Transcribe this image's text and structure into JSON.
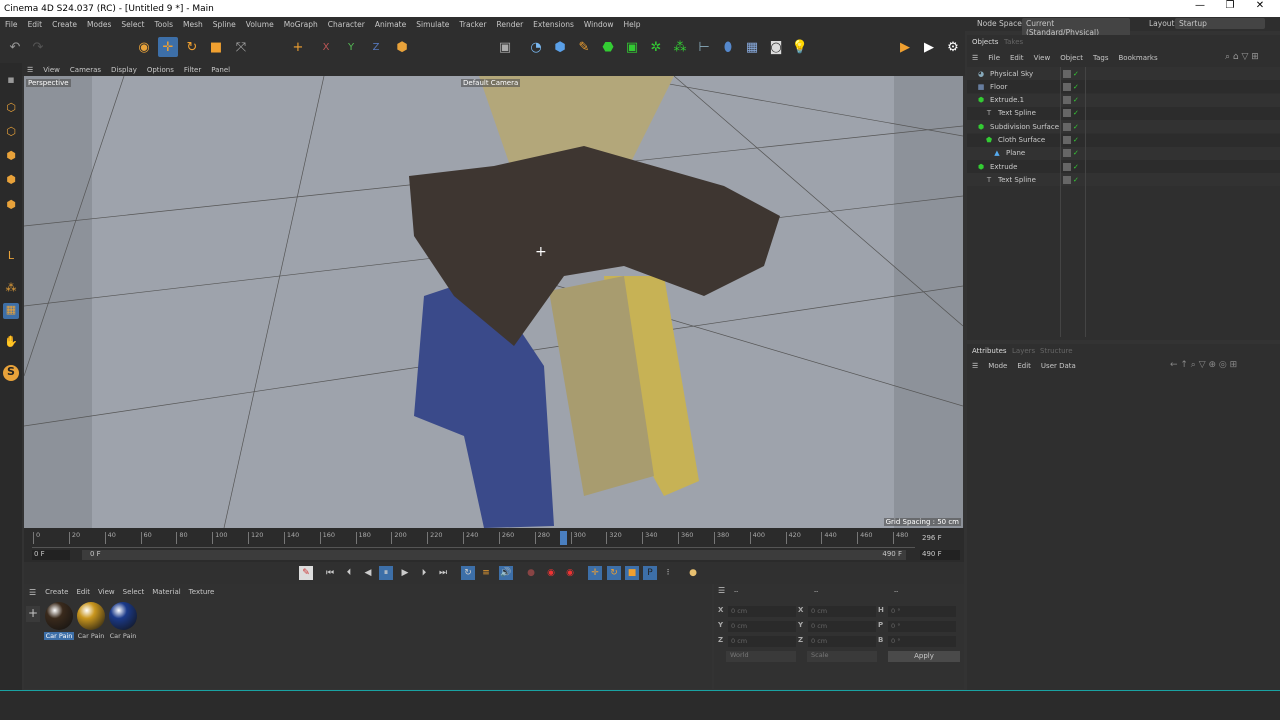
{
  "window": {
    "title": "Cinema 4D S24.037 (RC) - [Untitled 9 *] - Main",
    "minimize": "—",
    "restore": "❐",
    "close": "✕"
  },
  "menu": [
    "File",
    "Edit",
    "Create",
    "Modes",
    "Select",
    "Tools",
    "Mesh",
    "Spline",
    "Volume",
    "MoGraph",
    "Character",
    "Animate",
    "Simulate",
    "Tracker",
    "Render",
    "Extensions",
    "Window",
    "Help"
  ],
  "nodespace": {
    "label": "Node Space:",
    "value": "Current (Standard/Physical)",
    "layout_label": "Layout:",
    "layout_value": "Startup"
  },
  "viewport": {
    "menu": [
      "View",
      "Cameras",
      "Display",
      "Options",
      "Filter",
      "Panel"
    ],
    "view_name": "Perspective",
    "camera": "Default Camera",
    "grid_spacing": "Grid Spacing : 50 cm"
  },
  "timeline": {
    "ticks": [
      0,
      20,
      40,
      60,
      80,
      100,
      120,
      140,
      160,
      180,
      200,
      220,
      240,
      260,
      280,
      300,
      320,
      340,
      360,
      380,
      400,
      420,
      440,
      460,
      480
    ],
    "current_frame": 296,
    "current_label": "296 F",
    "start": "0 F",
    "range_start": "0 F",
    "range_end": "490 F",
    "end": "490 F",
    "max": 490
  },
  "materials": {
    "menu": [
      "Create",
      "Edit",
      "View",
      "Select",
      "Material",
      "Texture"
    ],
    "items": [
      {
        "name": "Car Pain",
        "color": "#3a2a1c"
      },
      {
        "name": "Car Pain",
        "color": "#c9961e"
      },
      {
        "name": "Car Pain",
        "color": "#1b3a8a"
      }
    ]
  },
  "coords": {
    "headers": [
      "--",
      "--",
      "--"
    ],
    "rows": [
      {
        "a": "X",
        "av": "0 cm",
        "b": "X",
        "bv": "0 cm",
        "c": "H",
        "cv": "0 °"
      },
      {
        "a": "Y",
        "av": "0 cm",
        "b": "Y",
        "bv": "0 cm",
        "c": "P",
        "cv": "0 °"
      },
      {
        "a": "Z",
        "av": "0 cm",
        "b": "Z",
        "bv": "0 cm",
        "c": "B",
        "cv": "0 °"
      }
    ],
    "world": "World",
    "scale": "Scale",
    "apply": "Apply"
  },
  "objects": {
    "tabs": [
      "Objects",
      "Takes"
    ],
    "menu": [
      "File",
      "Edit",
      "View",
      "Object",
      "Tags",
      "Bookmarks"
    ],
    "items": [
      {
        "name": "Physical Sky",
        "depth": 0,
        "icon": "sky"
      },
      {
        "name": "Floor",
        "depth": 0,
        "icon": "floor"
      },
      {
        "name": "Extrude.1",
        "depth": 0,
        "icon": "extrude"
      },
      {
        "name": "Text Spline",
        "depth": 1,
        "icon": "text"
      },
      {
        "name": "Subdivision Surface",
        "depth": 0,
        "icon": "subdiv"
      },
      {
        "name": "Cloth Surface",
        "depth": 1,
        "icon": "cloth"
      },
      {
        "name": "Plane",
        "depth": 2,
        "icon": "plane"
      },
      {
        "name": "Extrude",
        "depth": 0,
        "icon": "extrude"
      },
      {
        "name": "Text Spline",
        "depth": 1,
        "icon": "text"
      }
    ]
  },
  "attributes": {
    "tabs": [
      "Attributes",
      "Layers",
      "Structure"
    ],
    "menu": [
      "Mode",
      "Edit",
      "User Data"
    ]
  }
}
